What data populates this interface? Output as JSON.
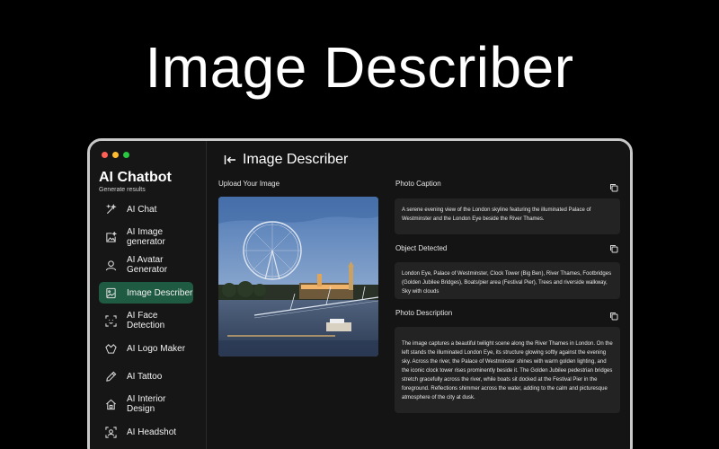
{
  "hero": {
    "title": "Image Describer"
  },
  "sidebar": {
    "app_title": "AI Chatbot",
    "app_subtitle": "Generate results",
    "items": [
      {
        "label": "AI Chat",
        "icon": "sparkle-pen-icon"
      },
      {
        "label": "AI Image generator",
        "icon": "image-sparkle-icon"
      },
      {
        "label": "AI Avatar Generator",
        "icon": "avatar-icon"
      },
      {
        "label": "Image Describer",
        "icon": "image-icon",
        "active": true
      },
      {
        "label": "AI Face Detection",
        "icon": "face-scan-icon"
      },
      {
        "label": "AI Logo Maker",
        "icon": "logo-icon"
      },
      {
        "label": "AI Tattoo",
        "icon": "tattoo-icon"
      },
      {
        "label": "AI Interior Design",
        "icon": "home-icon"
      },
      {
        "label": "AI Headshot",
        "icon": "headshot-icon"
      }
    ]
  },
  "main": {
    "page_title": "Image Describer",
    "upload_label": "Upload Your Image",
    "caption": {
      "label": "Photo Caption",
      "text": "A serene evening view of the London skyline featuring the illuminated Palace of Westminster and the London Eye beside the River Thames."
    },
    "objects": {
      "label": "Object Detected",
      "text": "London Eye, Palace of Westminster, Clock Tower (Big Ben), River Thames, Footbridges (Golden Jubilee Bridges), Boats/pier area (Festival Pier), Trees and riverside walkway, Sky with clouds"
    },
    "description": {
      "label": "Photo Description",
      "text": "The image captures a beautiful twilight scene along the River Thames in London. On the left stands the illuminated London Eye, its structure glowing softly against the evening sky. Across the river, the Palace of Westminster shines with warm golden lighting, and the iconic clock tower rises prominently beside it. The Golden Jubilee pedestrian bridges stretch gracefully across the river, while boats sit docked at the Festival Pier in the foreground. Reflections shimmer across the water, adding to the calm and picturesque atmosphere of the city at dusk."
    }
  },
  "colors": {
    "accent": "#1f5a43",
    "panel": "#232323",
    "background": "#000000"
  }
}
